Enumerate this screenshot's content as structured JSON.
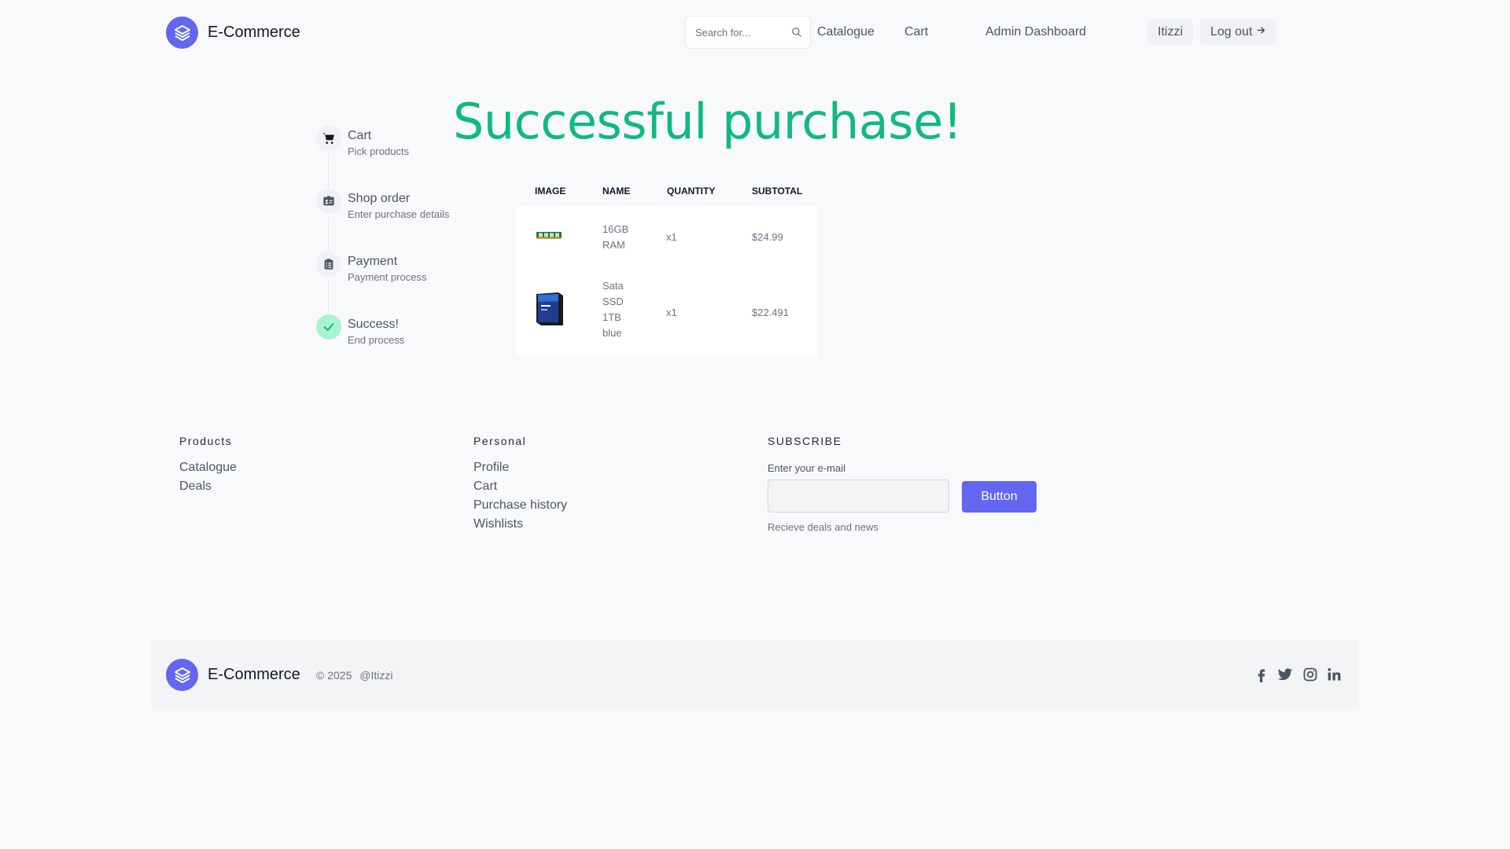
{
  "header": {
    "brand": "E-Commerce",
    "search_placeholder": "Search for...",
    "nav": {
      "catalogue": "Catalogue",
      "cart": "Cart",
      "admin": "Admin Dashboard"
    },
    "user": "Itizzi",
    "logout": "Log out"
  },
  "title": "Successful purchase!",
  "steps": [
    {
      "title": "Cart",
      "subtitle": "Pick products",
      "icon": "cart-icon"
    },
    {
      "title": "Shop order",
      "subtitle": "Enter purchase details",
      "icon": "id-card-icon"
    },
    {
      "title": "Payment",
      "subtitle": "Payment process",
      "icon": "clipboard-icon"
    },
    {
      "title": "Success!",
      "subtitle": "End process",
      "icon": "check-icon"
    }
  ],
  "table": {
    "headers": {
      "image": "IMAGE",
      "name": "NAME",
      "quantity": "QUANTITY",
      "subtotal": "SUBTOTAL"
    },
    "rows": [
      {
        "image": "ram-image",
        "name_lines": [
          "16GB",
          "RAM"
        ],
        "quantity": "x1",
        "subtotal": "$24.99"
      },
      {
        "image": "ssd-image",
        "name_lines": [
          "Sata",
          "SSD",
          "1TB",
          "blue"
        ],
        "quantity": "x1",
        "subtotal": "$22.491"
      }
    ]
  },
  "footer": {
    "products": {
      "title": "Products",
      "links": [
        "Catalogue",
        "Deals"
      ]
    },
    "personal": {
      "title": "Personal",
      "links": [
        "Profile",
        "Cart",
        "Purchase history",
        "Wishlists"
      ]
    },
    "subscribe": {
      "title": "SUBSCRIBE",
      "label": "Enter your e-mail",
      "button": "Button",
      "note": "Recieve deals and news"
    }
  },
  "bottom": {
    "brand": "E-Commerce",
    "copyright": "© 2025",
    "handle": "@Itizzi",
    "social": [
      "facebook-icon",
      "twitter-icon",
      "instagram-icon",
      "linkedin-icon"
    ]
  },
  "colors": {
    "accent": "#6366f1",
    "success": "#10b981",
    "background": "#f8f9fb"
  }
}
